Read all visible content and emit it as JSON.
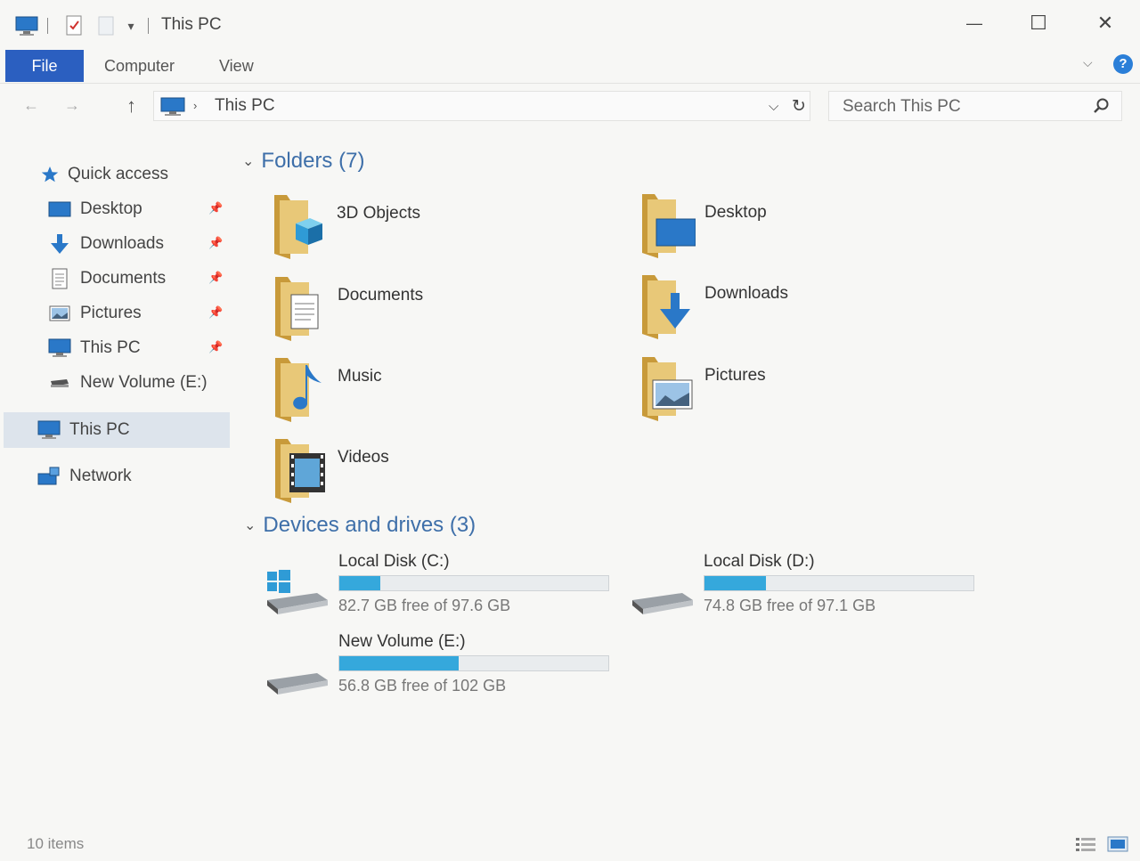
{
  "window": {
    "title": "This PC",
    "minimize_glyph": "—",
    "maximize_glyph": "☐",
    "close_glyph": "✕",
    "qat_dropdown_glyph": "▾"
  },
  "ribbon": {
    "tabs": [
      {
        "label": "File"
      },
      {
        "label": "Computer"
      },
      {
        "label": "View"
      }
    ],
    "collapse_glyph": "⌵",
    "help_glyph": "?"
  },
  "address": {
    "back_glyph": "←",
    "forward_glyph": "→",
    "up_glyph": "↑",
    "separator_glyph": "›",
    "breadcrumb": "This PC",
    "dropdown_glyph": "⌵",
    "refresh_glyph": "↻",
    "search_placeholder": "Search This PC"
  },
  "sidebar": {
    "quick_access": "Quick access",
    "pin_glyph": "📌",
    "quick_items": [
      {
        "label": "Desktop",
        "icon": "desktop-icon",
        "pinned": true
      },
      {
        "label": "Downloads",
        "icon": "download-arrow-icon",
        "pinned": true
      },
      {
        "label": "Documents",
        "icon": "document-icon",
        "pinned": true
      },
      {
        "label": "Pictures",
        "icon": "picture-icon",
        "pinned": true
      },
      {
        "label": "This PC",
        "icon": "monitor-icon",
        "pinned": true
      },
      {
        "label": "New Volume (E:)",
        "icon": "drive-icon",
        "pinned": false
      }
    ],
    "this_pc": "This PC",
    "network": "Network"
  },
  "content": {
    "folders_header": "Folders (7)",
    "folders": [
      {
        "label": "3D Objects",
        "overlay": "cube-icon"
      },
      {
        "label": "Desktop",
        "overlay": "desktop-icon"
      },
      {
        "label": "Documents",
        "overlay": "document-icon"
      },
      {
        "label": "Downloads",
        "overlay": "download-arrow-icon"
      },
      {
        "label": "Music",
        "overlay": "music-note-icon"
      },
      {
        "label": "Pictures",
        "overlay": "picture-icon"
      },
      {
        "label": "Videos",
        "overlay": "film-icon"
      }
    ],
    "drives_header": "Devices and drives (3)",
    "drives": [
      {
        "name": "Local Disk (C:)",
        "free_text": "82.7 GB free of 97.6 GB",
        "used_fraction": 0.153,
        "system": true
      },
      {
        "name": "Local Disk (D:)",
        "free_text": "74.8 GB free of 97.1 GB",
        "used_fraction": 0.23,
        "system": false
      },
      {
        "name": "New Volume (E:)",
        "free_text": "56.8 GB free of 102 GB",
        "used_fraction": 0.443,
        "system": false
      }
    ]
  },
  "status": {
    "items_text": "10 items"
  },
  "colors": {
    "accent": "#2b5fc0",
    "header_blue": "#3e6fa9",
    "drive_fill": "#35a8dc",
    "folder_yellow": "#e8c878"
  }
}
